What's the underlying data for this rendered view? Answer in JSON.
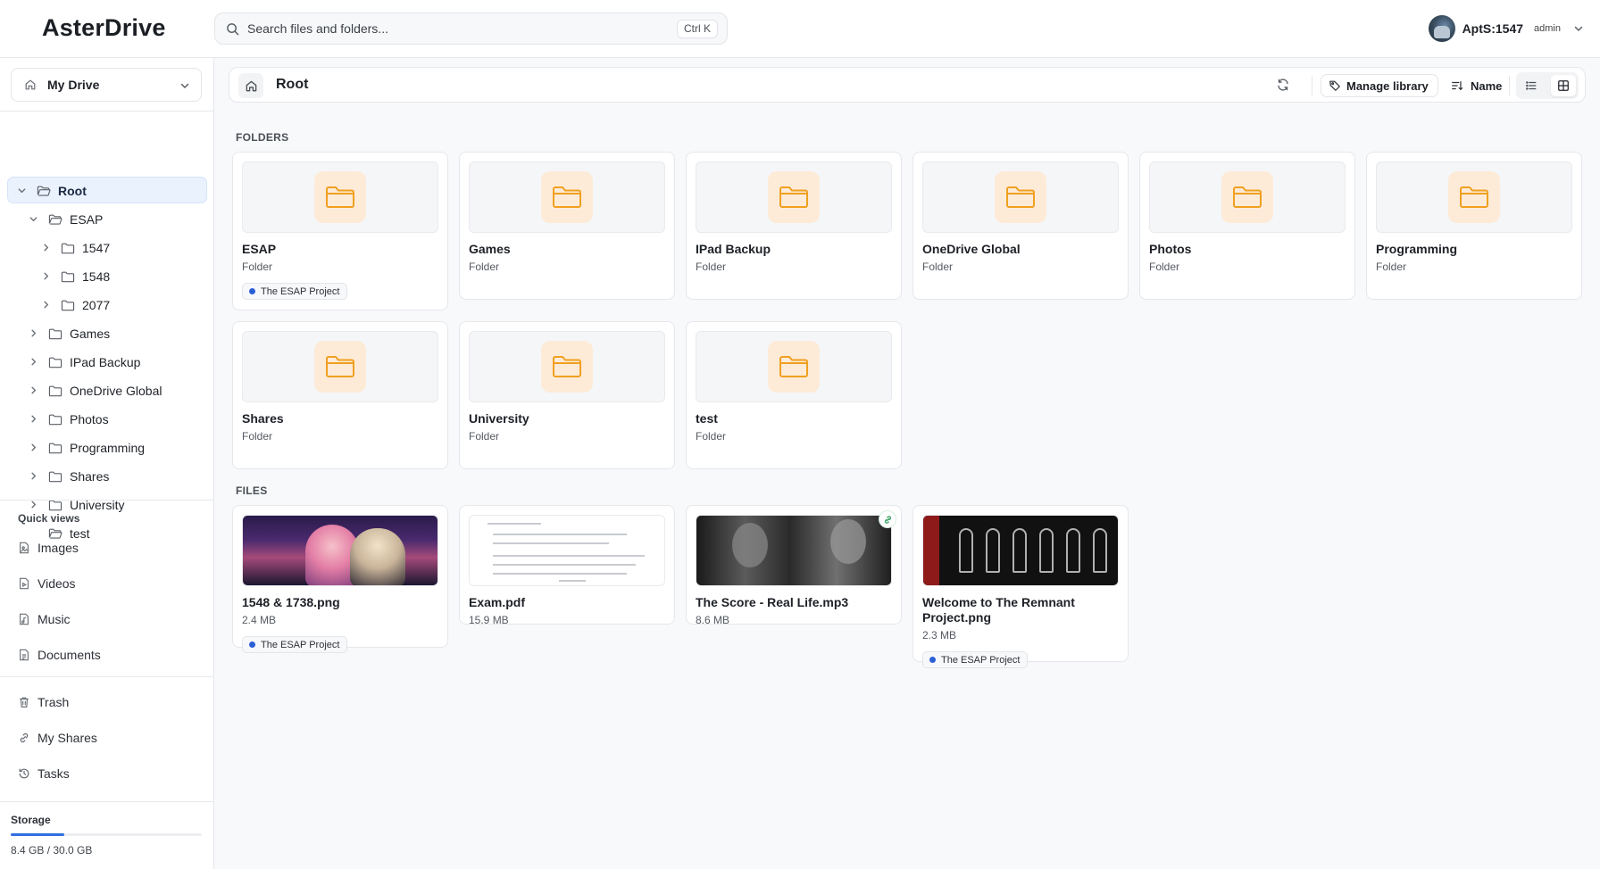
{
  "app": {
    "brand": "AsterDrive"
  },
  "search": {
    "placeholder": "Search files and folders...",
    "shortcut": "Ctrl K"
  },
  "user": {
    "name": "AptS:1547",
    "role": "admin"
  },
  "sidebar": {
    "drive": "My Drive",
    "tree": [
      {
        "label": "Root",
        "level": 0,
        "expanded": true,
        "active": true
      },
      {
        "label": "ESAP",
        "level": 1,
        "expanded": true
      },
      {
        "label": "1547",
        "level": 2
      },
      {
        "label": "1548",
        "level": 2
      },
      {
        "label": "2077",
        "level": 2
      },
      {
        "label": "Games",
        "level": 1
      },
      {
        "label": "IPad Backup",
        "level": 1
      },
      {
        "label": "OneDrive Global",
        "level": 1
      },
      {
        "label": "Photos",
        "level": 1
      },
      {
        "label": "Programming",
        "level": 1
      },
      {
        "label": "Shares",
        "level": 1
      },
      {
        "label": "University",
        "level": 1
      },
      {
        "label": "test",
        "level": 1,
        "leaf": true
      }
    ],
    "quick_views_title": "Quick views",
    "quick_views": [
      "Images",
      "Videos",
      "Music",
      "Documents"
    ],
    "nav": [
      "Trash",
      "My Shares",
      "Tasks"
    ],
    "storage": {
      "title": "Storage",
      "text": "8.4 GB / 30.0 GB",
      "fraction": 0.28
    }
  },
  "toolbar": {
    "breadcrumb": "Root",
    "manage_library": "Manage library",
    "sort": "Name",
    "view": "grid"
  },
  "content": {
    "folders_title": "FOLDERS",
    "files_title": "FILES",
    "folders": [
      {
        "name": "ESAP",
        "type": "Folder",
        "tag": "The ESAP Project"
      },
      {
        "name": "Games",
        "type": "Folder"
      },
      {
        "name": "IPad Backup",
        "type": "Folder"
      },
      {
        "name": "OneDrive Global",
        "type": "Folder"
      },
      {
        "name": "Photos",
        "type": "Folder"
      },
      {
        "name": "Programming",
        "type": "Folder"
      },
      {
        "name": "Shares",
        "type": "Folder"
      },
      {
        "name": "University",
        "type": "Folder"
      },
      {
        "name": "test",
        "type": "Folder"
      }
    ],
    "files": [
      {
        "name": "1548 & 1738.png",
        "size": "2.4 MB",
        "tag": "The ESAP Project",
        "thumb": "anime-image"
      },
      {
        "name": "Exam.pdf",
        "size": "15.9 MB",
        "thumb": "pdf-page"
      },
      {
        "name": "The Score - Real Life.mp3",
        "size": "8.6 MB",
        "thumb": "album-cover",
        "shared": true
      },
      {
        "name": "Welcome to The Remnant Project.png",
        "size": "2.3 MB",
        "tag": "The ESAP Project",
        "thumb": "poster-image"
      }
    ]
  },
  "colors": {
    "accent": "#2f6fe0",
    "folder": "#f0a020",
    "folder_bg": "#fdebd8",
    "tag_dot": "#2a5fd6",
    "active_bg": "#eaf2fe"
  }
}
